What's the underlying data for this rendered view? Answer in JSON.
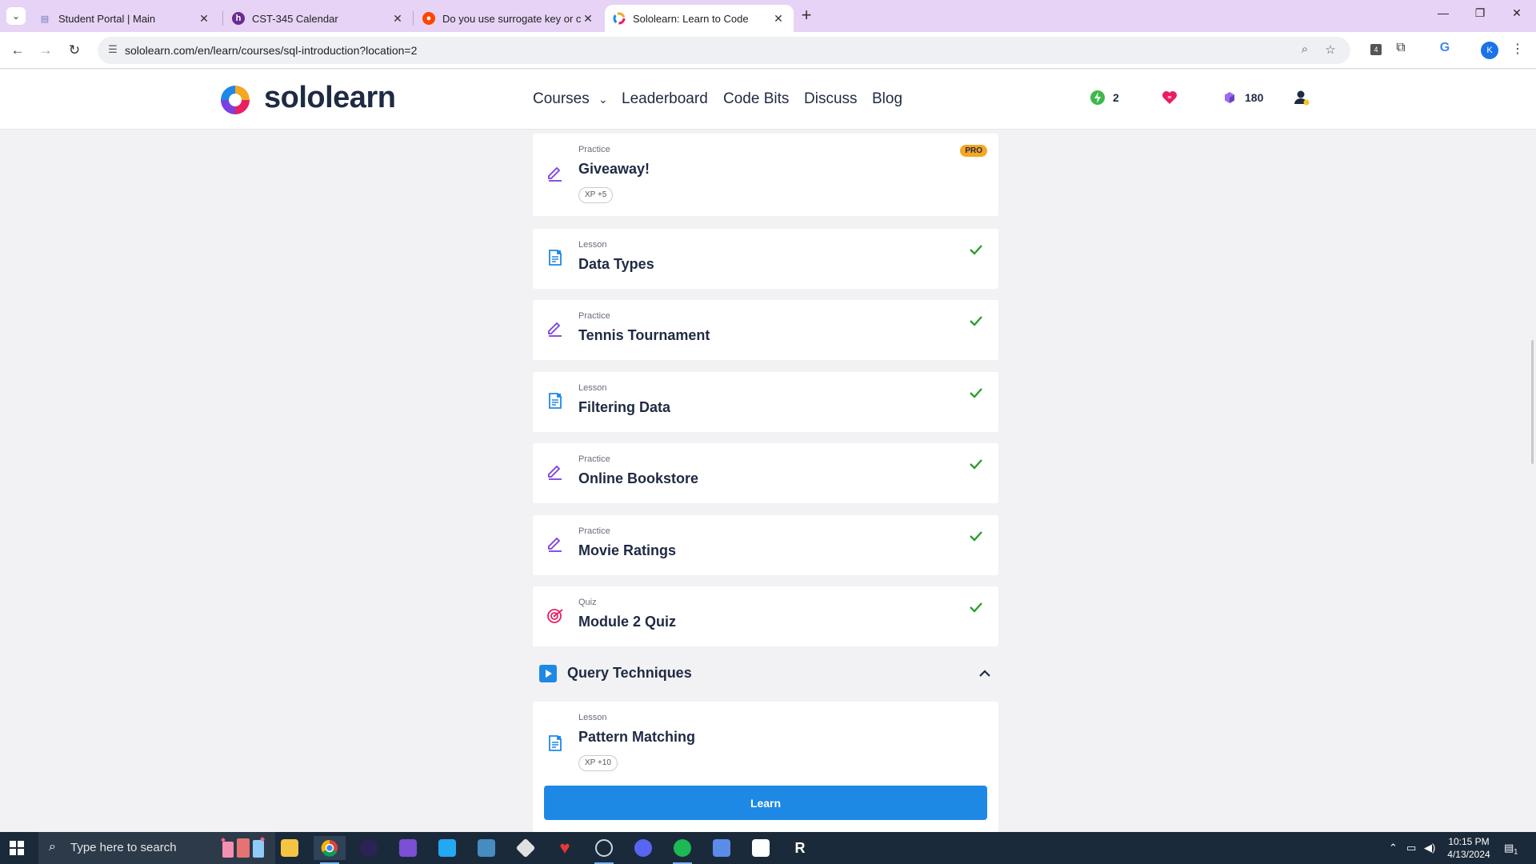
{
  "browser": {
    "tabs": [
      {
        "title": "Student Portal | Main",
        "favicon": "document-icon"
      },
      {
        "title": "CST-345 Calendar",
        "favicon": "h-logo-icon"
      },
      {
        "title": "Do you use surrogate key or co",
        "favicon": "reddit-icon"
      },
      {
        "title": "Sololearn: Learn to Code",
        "favicon": "sololearn-icon"
      }
    ],
    "url": "sololearn.com/en/learn/courses/sql-introduction?location=2",
    "extensions_badge": "4",
    "profile_initial": "K"
  },
  "site": {
    "logo_text": "sololearn",
    "nav": {
      "courses": "Courses",
      "leaderboard": "Leaderboard",
      "code_bits": "Code Bits",
      "discuss": "Discuss",
      "blog": "Blog"
    },
    "streak": "2",
    "gems": "180"
  },
  "items": [
    {
      "type": "Practice",
      "title": "Giveaway!",
      "badge": "PRO",
      "xp": "XP +5"
    },
    {
      "type": "Lesson",
      "title": "Data Types"
    },
    {
      "type": "Practice",
      "title": "Tennis Tournament"
    },
    {
      "type": "Lesson",
      "title": "Filtering Data"
    },
    {
      "type": "Practice",
      "title": "Online Bookstore"
    },
    {
      "type": "Practice",
      "title": "Movie Ratings"
    },
    {
      "type": "Quiz",
      "title": "Module 2 Quiz"
    }
  ],
  "section": {
    "title": "Query Techniques"
  },
  "current": {
    "type": "Lesson",
    "title": "Pattern Matching",
    "xp": "XP +10",
    "button": "Learn"
  },
  "taskbar": {
    "search_placeholder": "Type here to search",
    "time": "10:15 PM",
    "date": "4/13/2024",
    "notifications": "1"
  },
  "colors": {
    "accent_blue": "#1e88e5",
    "check_green": "#2e9e2e",
    "practice_purple": "#7b3fe4",
    "quiz_pink": "#e91e63",
    "pro_orange": "#f5a623"
  }
}
